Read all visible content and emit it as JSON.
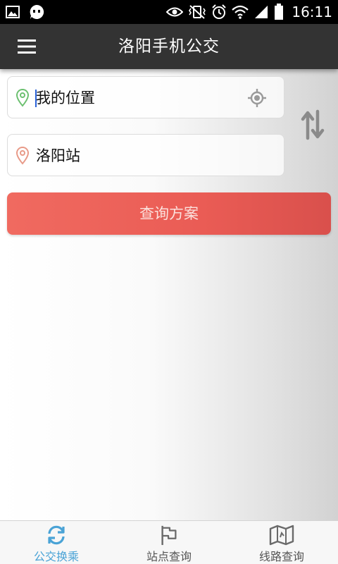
{
  "status_bar": {
    "time": "16:11",
    "icons": [
      "image-icon",
      "message-icon",
      "eye-icon",
      "vibrate-mute-icon",
      "alarm-icon",
      "wifi-icon",
      "signal-icon",
      "battery-icon"
    ]
  },
  "app_bar": {
    "title": "洛阳手机公交",
    "menu_icon": "menu-icon"
  },
  "route_form": {
    "from_value": "我的位置",
    "to_value": "洛阳站",
    "query_label": "查询方案"
  },
  "bottom_nav": {
    "items": [
      {
        "label": "公交换乘",
        "icon": "transfer-icon",
        "active": true
      },
      {
        "label": "站点查询",
        "icon": "flag-icon",
        "active": false
      },
      {
        "label": "线路查询",
        "icon": "map-icon",
        "active": false
      }
    ]
  },
  "colors": {
    "accent": "#4aa3d6",
    "query_button": "#ea5c55",
    "app_bar": "#333333",
    "from_pin": "#6cc070",
    "to_pin": "#e89a88"
  }
}
